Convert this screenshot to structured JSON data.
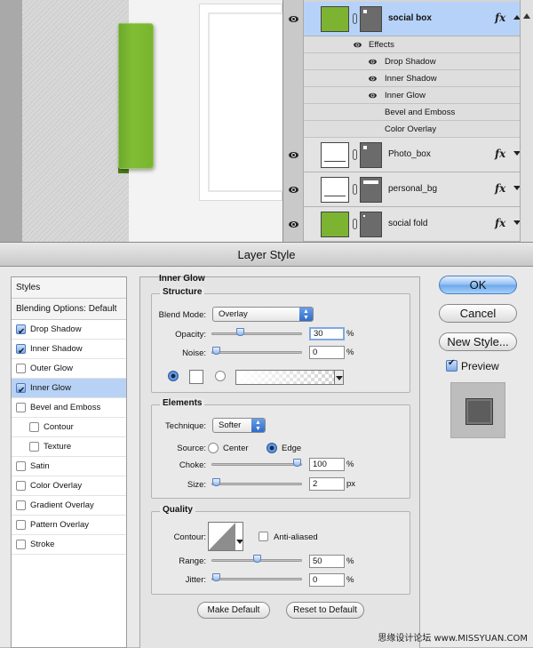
{
  "layers": [
    {
      "name": "social box",
      "selected": true,
      "visible": true,
      "thumb": "green",
      "fx": "fx"
    },
    {
      "name": "Photo_box",
      "selected": false,
      "visible": true,
      "thumb": "white",
      "fx": "fx"
    },
    {
      "name": "personal_bg",
      "selected": false,
      "visible": true,
      "thumb": "white",
      "fx": "fx"
    },
    {
      "name": "social fold",
      "selected": false,
      "visible": true,
      "thumb": "green",
      "fx": "fx"
    }
  ],
  "effects": {
    "header": "Effects",
    "items": [
      "Drop Shadow",
      "Inner Shadow",
      "Inner Glow",
      "Bevel and Emboss",
      "Color Overlay"
    ]
  },
  "dialog": {
    "title": "Layer Style",
    "styles_header": "Styles",
    "blending_options": "Blending Options: Default",
    "style_items": [
      {
        "label": "Drop Shadow",
        "checked": true
      },
      {
        "label": "Inner Shadow",
        "checked": true
      },
      {
        "label": "Outer Glow",
        "checked": false
      },
      {
        "label": "Inner Glow",
        "checked": true
      },
      {
        "label": "Bevel and Emboss",
        "checked": false
      },
      {
        "label": "Contour",
        "checked": false
      },
      {
        "label": "Texture",
        "checked": false
      },
      {
        "label": "Satin",
        "checked": false
      },
      {
        "label": "Color Overlay",
        "checked": false
      },
      {
        "label": "Gradient Overlay",
        "checked": false
      },
      {
        "label": "Pattern Overlay",
        "checked": false
      },
      {
        "label": "Stroke",
        "checked": false
      }
    ],
    "panel_title": "Inner Glow",
    "structure": {
      "title": "Structure",
      "blend_mode_label": "Blend Mode:",
      "blend_mode_value": "Overlay",
      "opacity_label": "Opacity:",
      "opacity_value": "30",
      "opacity_fraction": 0.3,
      "noise_label": "Noise:",
      "noise_value": "0",
      "noise_fraction": 0,
      "percent": "%"
    },
    "elements": {
      "title": "Elements",
      "technique_label": "Technique:",
      "technique_value": "Softer",
      "source_label": "Source:",
      "center_label": "Center",
      "edge_label": "Edge",
      "choke_label": "Choke:",
      "choke_value": "100",
      "choke_fraction": 1.0,
      "size_label": "Size:",
      "size_value": "2",
      "size_fraction": 0.0,
      "px": "px"
    },
    "quality": {
      "title": "Quality",
      "contour_label": "Contour:",
      "anti_aliased_label": "Anti-aliased",
      "range_label": "Range:",
      "range_value": "50",
      "range_fraction": 0.5,
      "jitter_label": "Jitter:",
      "jitter_value": "0",
      "jitter_fraction": 0
    },
    "make_default": "Make Default",
    "reset_default": "Reset to Default",
    "ok": "OK",
    "cancel": "Cancel",
    "new_style": "New Style...",
    "preview_label": "Preview"
  },
  "watermark": "思缘设计论坛  www.MISSYUAN.COM"
}
